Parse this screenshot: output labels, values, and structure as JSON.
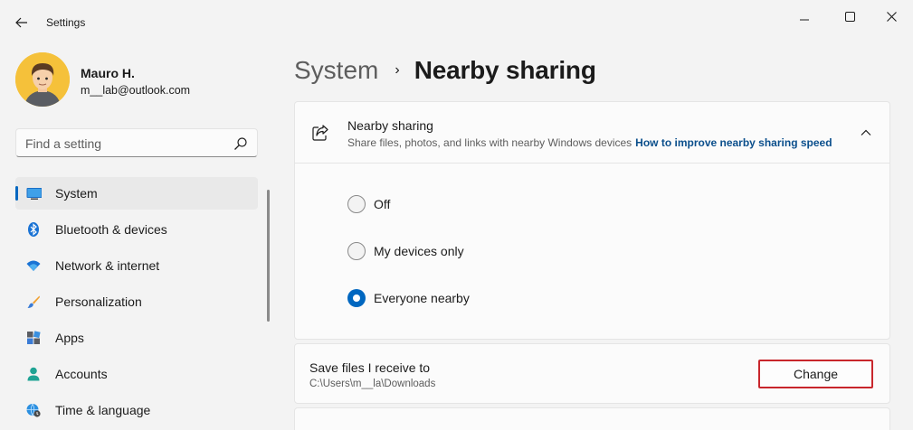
{
  "window": {
    "title": "Settings"
  },
  "profile": {
    "name": "Mauro H.",
    "email": "m__lab@outlook.com"
  },
  "search": {
    "placeholder": "Find a setting"
  },
  "sidebar": {
    "items": [
      {
        "label": "System",
        "icon": "monitor-icon",
        "active": true
      },
      {
        "label": "Bluetooth & devices",
        "icon": "bluetooth-icon",
        "active": false
      },
      {
        "label": "Network & internet",
        "icon": "wifi-icon",
        "active": false
      },
      {
        "label": "Personalization",
        "icon": "paintbrush-icon",
        "active": false
      },
      {
        "label": "Apps",
        "icon": "apps-icon",
        "active": false
      },
      {
        "label": "Accounts",
        "icon": "person-icon",
        "active": false
      },
      {
        "label": "Time & language",
        "icon": "globe-clock-icon",
        "active": false
      }
    ]
  },
  "header": {
    "parent": "System",
    "separator": "›",
    "current": "Nearby sharing"
  },
  "nearby": {
    "title": "Nearby sharing",
    "description": "Share files, photos, and links with nearby Windows devices",
    "help_link": "How to improve nearby sharing speed",
    "options": [
      {
        "label": "Off",
        "selected": false
      },
      {
        "label": "My devices only",
        "selected": false
      },
      {
        "label": "Everyone nearby",
        "selected": true
      }
    ]
  },
  "save_files": {
    "title": "Save files I receive to",
    "path": "C:\\Users\\m__la\\Downloads",
    "button_label": "Change"
  },
  "colors": {
    "accent": "#0067c0",
    "highlight_box": "#c8262c",
    "link": "#0b4f8c"
  }
}
